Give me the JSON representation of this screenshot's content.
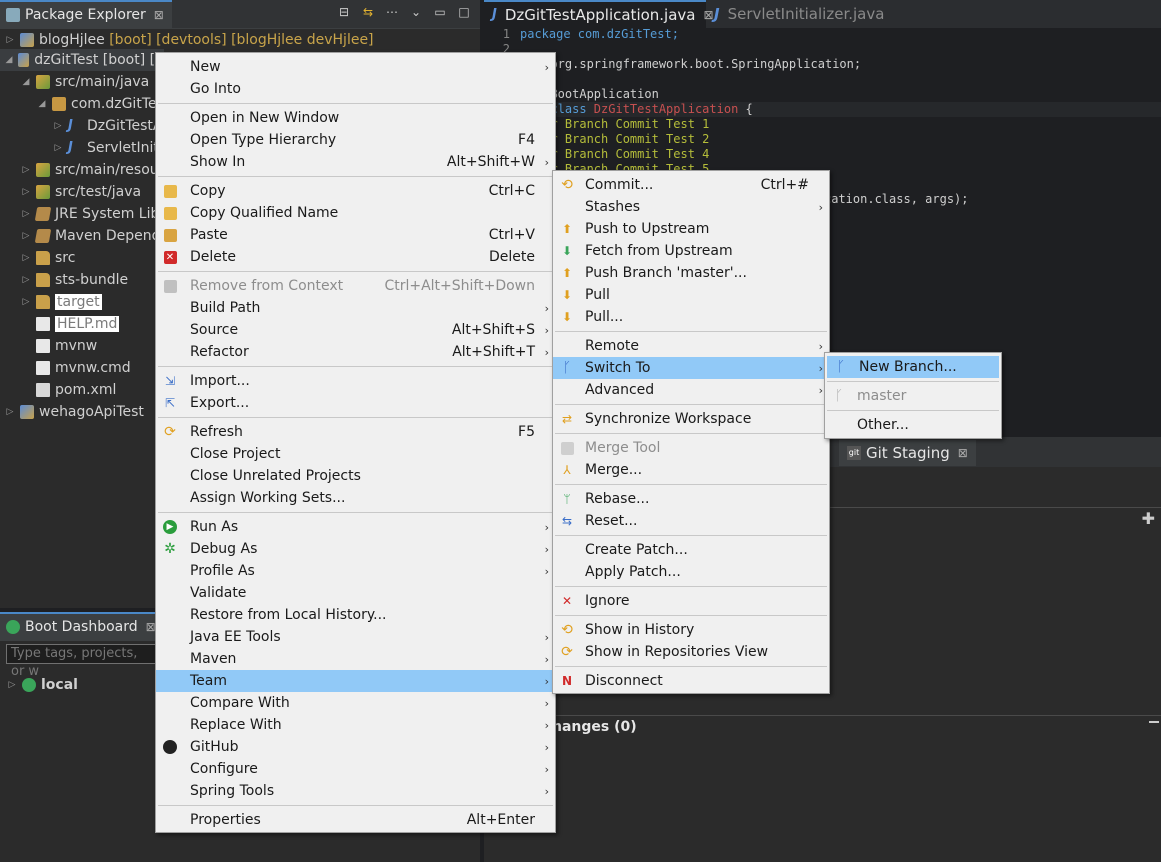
{
  "package_explorer": {
    "title": "Package Explorer",
    "close": "⊠",
    "tree": [
      {
        "label": "blogHjlee",
        "decoration": "[boot] [devtools] [blogHjlee devHjlee]"
      },
      {
        "label": "dzGitTest [boot] [d"
      },
      {
        "label": "src/main/java"
      },
      {
        "label": "com.dzGitTes"
      },
      {
        "label": "DzGitTestA"
      },
      {
        "label": "ServletIniti"
      },
      {
        "label": "src/main/resour"
      },
      {
        "label": "src/test/java"
      },
      {
        "label": "JRE System Libr"
      },
      {
        "label": "Maven Depende"
      },
      {
        "label": "src"
      },
      {
        "label": "sts-bundle"
      },
      {
        "label": "target"
      },
      {
        "label": "HELP.md"
      },
      {
        "label": "mvnw"
      },
      {
        "label": "mvnw.cmd"
      },
      {
        "label": "pom.xml"
      },
      {
        "label": "wehagoApiTest"
      }
    ]
  },
  "boot_dashboard": {
    "title": "Boot Dashboard",
    "close": "⊠",
    "search_placeholder": "Type tags, projects, or w",
    "item": "local"
  },
  "editor": {
    "tabs": [
      {
        "label": "DzGitTestApplication.java",
        "close": "⊠"
      },
      {
        "label": "ServletInitializer.java"
      }
    ],
    "lines": [
      {
        "n": "1",
        "text": "package com.dzGitTest;"
      },
      {
        "n": "2",
        "text": ""
      },
      {
        "n": "",
        "text": "t org.springframework.boot.SpringApplication;"
      },
      {
        "n": "",
        "text": "ngBootApplication"
      },
      {
        "n": "",
        "text_kw": "c class ",
        "text_cls": "DzGitTestApplication",
        "text_rest": " {"
      },
      {
        "n": "",
        "text": "ter Branch Commit Test 1"
      },
      {
        "n": "",
        "text": "ter Branch Commit Test 2"
      },
      {
        "n": "",
        "text": "ter Branch Commit Test 4"
      },
      {
        "n": "",
        "text": "ter Branch Commit Test 5"
      },
      {
        "n": "",
        "text": "cation.class, args);"
      }
    ]
  },
  "git_staging": {
    "title": "Git Staging",
    "close": "⊠",
    "changes_label": "hanges (0)"
  },
  "context_menu": {
    "items": [
      {
        "label": "New",
        "arrow": "›"
      },
      {
        "label": "Go Into"
      },
      {
        "label": "Open in New Window"
      },
      {
        "label": "Open Type Hierarchy",
        "acc": "F4"
      },
      {
        "label": "Show In",
        "acc": "Alt+Shift+W",
        "arrow": "›"
      },
      {
        "label": "Copy",
        "acc": "Ctrl+C"
      },
      {
        "label": "Copy Qualified Name"
      },
      {
        "label": "Paste",
        "acc": "Ctrl+V"
      },
      {
        "label": "Delete",
        "acc": "Delete"
      },
      {
        "label": "Remove from Context",
        "acc": "Ctrl+Alt+Shift+Down"
      },
      {
        "label": "Build Path",
        "arrow": "›"
      },
      {
        "label": "Source",
        "acc": "Alt+Shift+S",
        "arrow": "›"
      },
      {
        "label": "Refactor",
        "acc": "Alt+Shift+T",
        "arrow": "›"
      },
      {
        "label": "Import..."
      },
      {
        "label": "Export..."
      },
      {
        "label": "Refresh",
        "acc": "F5"
      },
      {
        "label": "Close Project"
      },
      {
        "label": "Close Unrelated Projects"
      },
      {
        "label": "Assign Working Sets..."
      },
      {
        "label": "Run As",
        "arrow": "›"
      },
      {
        "label": "Debug As",
        "arrow": "›"
      },
      {
        "label": "Profile As",
        "arrow": "›"
      },
      {
        "label": "Validate"
      },
      {
        "label": "Restore from Local History..."
      },
      {
        "label": "Java EE Tools",
        "arrow": "›"
      },
      {
        "label": "Maven",
        "arrow": "›"
      },
      {
        "label": "Team",
        "arrow": "›"
      },
      {
        "label": "Compare With",
        "arrow": "›"
      },
      {
        "label": "Replace With",
        "arrow": "›"
      },
      {
        "label": "GitHub",
        "arrow": "›"
      },
      {
        "label": "Configure",
        "arrow": "›"
      },
      {
        "label": "Spring Tools",
        "arrow": "›"
      },
      {
        "label": "Properties",
        "acc": "Alt+Enter"
      }
    ]
  },
  "team_menu": {
    "items": [
      {
        "label": "Commit...",
        "acc": "Ctrl+#"
      },
      {
        "label": "Stashes",
        "arrow": "›"
      },
      {
        "label": "Push to Upstream"
      },
      {
        "label": "Fetch from Upstream"
      },
      {
        "label": "Push Branch 'master'..."
      },
      {
        "label": "Pull"
      },
      {
        "label": "Pull..."
      },
      {
        "label": "Remote",
        "arrow": "›"
      },
      {
        "label": "Switch To",
        "arrow": "›"
      },
      {
        "label": "Advanced",
        "arrow": "›"
      },
      {
        "label": "Synchronize Workspace"
      },
      {
        "label": "Merge Tool"
      },
      {
        "label": "Merge..."
      },
      {
        "label": "Rebase..."
      },
      {
        "label": "Reset..."
      },
      {
        "label": "Create Patch..."
      },
      {
        "label": "Apply Patch..."
      },
      {
        "label": "Ignore"
      },
      {
        "label": "Show in History"
      },
      {
        "label": "Show in Repositories View"
      },
      {
        "label": "Disconnect"
      }
    ]
  },
  "switch_menu": {
    "items": [
      {
        "label": "New Branch..."
      },
      {
        "label": "master"
      },
      {
        "label": "Other..."
      }
    ]
  },
  "colors": {
    "highlight": "#91c9f7",
    "menu_bg": "#f0f0f0",
    "accent": "#4a88c7"
  }
}
